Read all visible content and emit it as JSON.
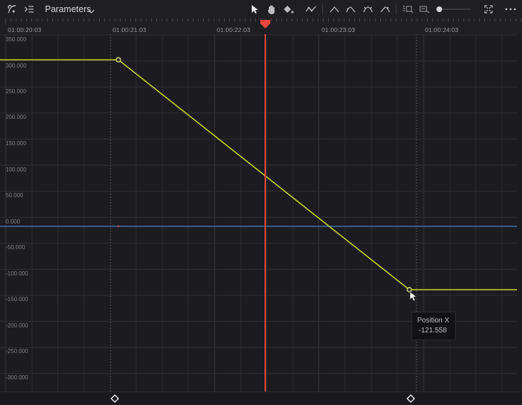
{
  "toolbar": {
    "parameters_label": "Parameters",
    "icons": [
      "curve-select-icon",
      "expand-list-icon",
      "chevron-down-icon",
      "pointer-icon",
      "hand-icon",
      "add-keyframe-icon",
      "smooth-keyframe-icon",
      "ease-in-icon",
      "ease-out-icon",
      "ease-both-icon",
      "linear-icon",
      "zoom-to-fit-icon",
      "zoom-selection-icon",
      "fullscreen-icon",
      "more-options-icon"
    ],
    "zoom_slider_level": 0.05
  },
  "ruler": {
    "timecodes": [
      "01:00:20:03",
      "01:00:21:03",
      "01:00:22:03",
      "01:00:23:03",
      "01:00:24:03"
    ]
  },
  "graph": {
    "y_labels": [
      "350.000",
      "300.000",
      "250.000",
      "200.000",
      "150.000",
      "100.000",
      "50.000",
      "0.000",
      "-50.000",
      "-100.000",
      "-150.000",
      "-200.000",
      "-250.000",
      "-300.000"
    ]
  },
  "tooltip": {
    "title": "Position X",
    "value": "-121.558"
  },
  "colors": {
    "curve": "#c6d62b",
    "playhead": "#e8463c",
    "zero_line": "#3f6ea3",
    "background": "#1c1c20"
  }
}
